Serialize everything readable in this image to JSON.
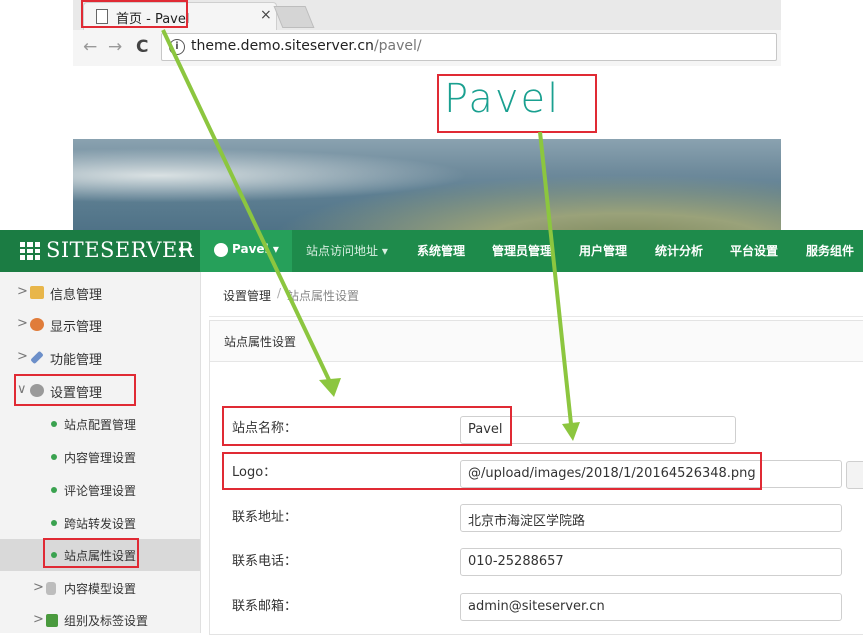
{
  "browser": {
    "tab_title": "首页 - Pavel",
    "tab_close": "×",
    "nav_back": "←",
    "nav_forward": "→",
    "nav_reload": "C",
    "info_glyph": "i",
    "url_host": "theme.demo.siteserver.cn",
    "url_path": "/pavel/"
  },
  "site": {
    "logo_text": "Pavel"
  },
  "topbar": {
    "brand": "SITESERVER",
    "back_glyph": "←",
    "site_switch": "Pavel ▾",
    "menu": [
      {
        "label": "站点访问地址 ▾"
      },
      {
        "label": "系统管理"
      },
      {
        "label": "管理员管理"
      },
      {
        "label": "用户管理"
      },
      {
        "label": "统计分析"
      },
      {
        "label": "平台设置"
      },
      {
        "label": "服务组件"
      }
    ]
  },
  "sidebar": {
    "items": [
      {
        "label": "信息管理",
        "chevron": ">",
        "icon": "folder-icon",
        "color": "#e8b64a"
      },
      {
        "label": "显示管理",
        "chevron": ">",
        "icon": "palette-icon",
        "color": "#e07c3a"
      },
      {
        "label": "功能管理",
        "chevron": ">",
        "icon": "wrench-icon",
        "color": "#6c8fc9"
      },
      {
        "label": "设置管理",
        "chevron": "∨",
        "icon": "gear-icon",
        "color": "#9a9a9a"
      }
    ],
    "sub_items": [
      {
        "label": "站点配置管理"
      },
      {
        "label": "内容管理设置"
      },
      {
        "label": "评论管理设置"
      },
      {
        "label": "跨站转发设置"
      },
      {
        "label": "站点属性设置"
      }
    ],
    "tail_items": [
      {
        "label": "内容模型设置",
        "chevron": ">",
        "icon": "database-icon"
      },
      {
        "label": "组别及标签设置",
        "chevron": ">",
        "icon": "sitemap-icon"
      }
    ]
  },
  "breadcrumb": {
    "parent": "设置管理",
    "separator": "/",
    "current": "站点属性设置"
  },
  "panel": {
    "title": "站点属性设置"
  },
  "form": {
    "fields": [
      {
        "label": "站点名称：",
        "value": "Pavel"
      },
      {
        "label": "Logo：",
        "value": "@/upload/images/2018/1/20164526348.png"
      },
      {
        "label": "联系地址：",
        "value": "北京市海淀区学院路"
      },
      {
        "label": "联系电话：",
        "value": "010-25288657"
      },
      {
        "label": "联系邮箱：",
        "value": "admin@siteserver.cn"
      }
    ]
  },
  "colors": {
    "topbar": "#1e8b4b",
    "highlight": "#e02a34",
    "arrow": "#8cc63f",
    "logo": "#1aa090"
  }
}
